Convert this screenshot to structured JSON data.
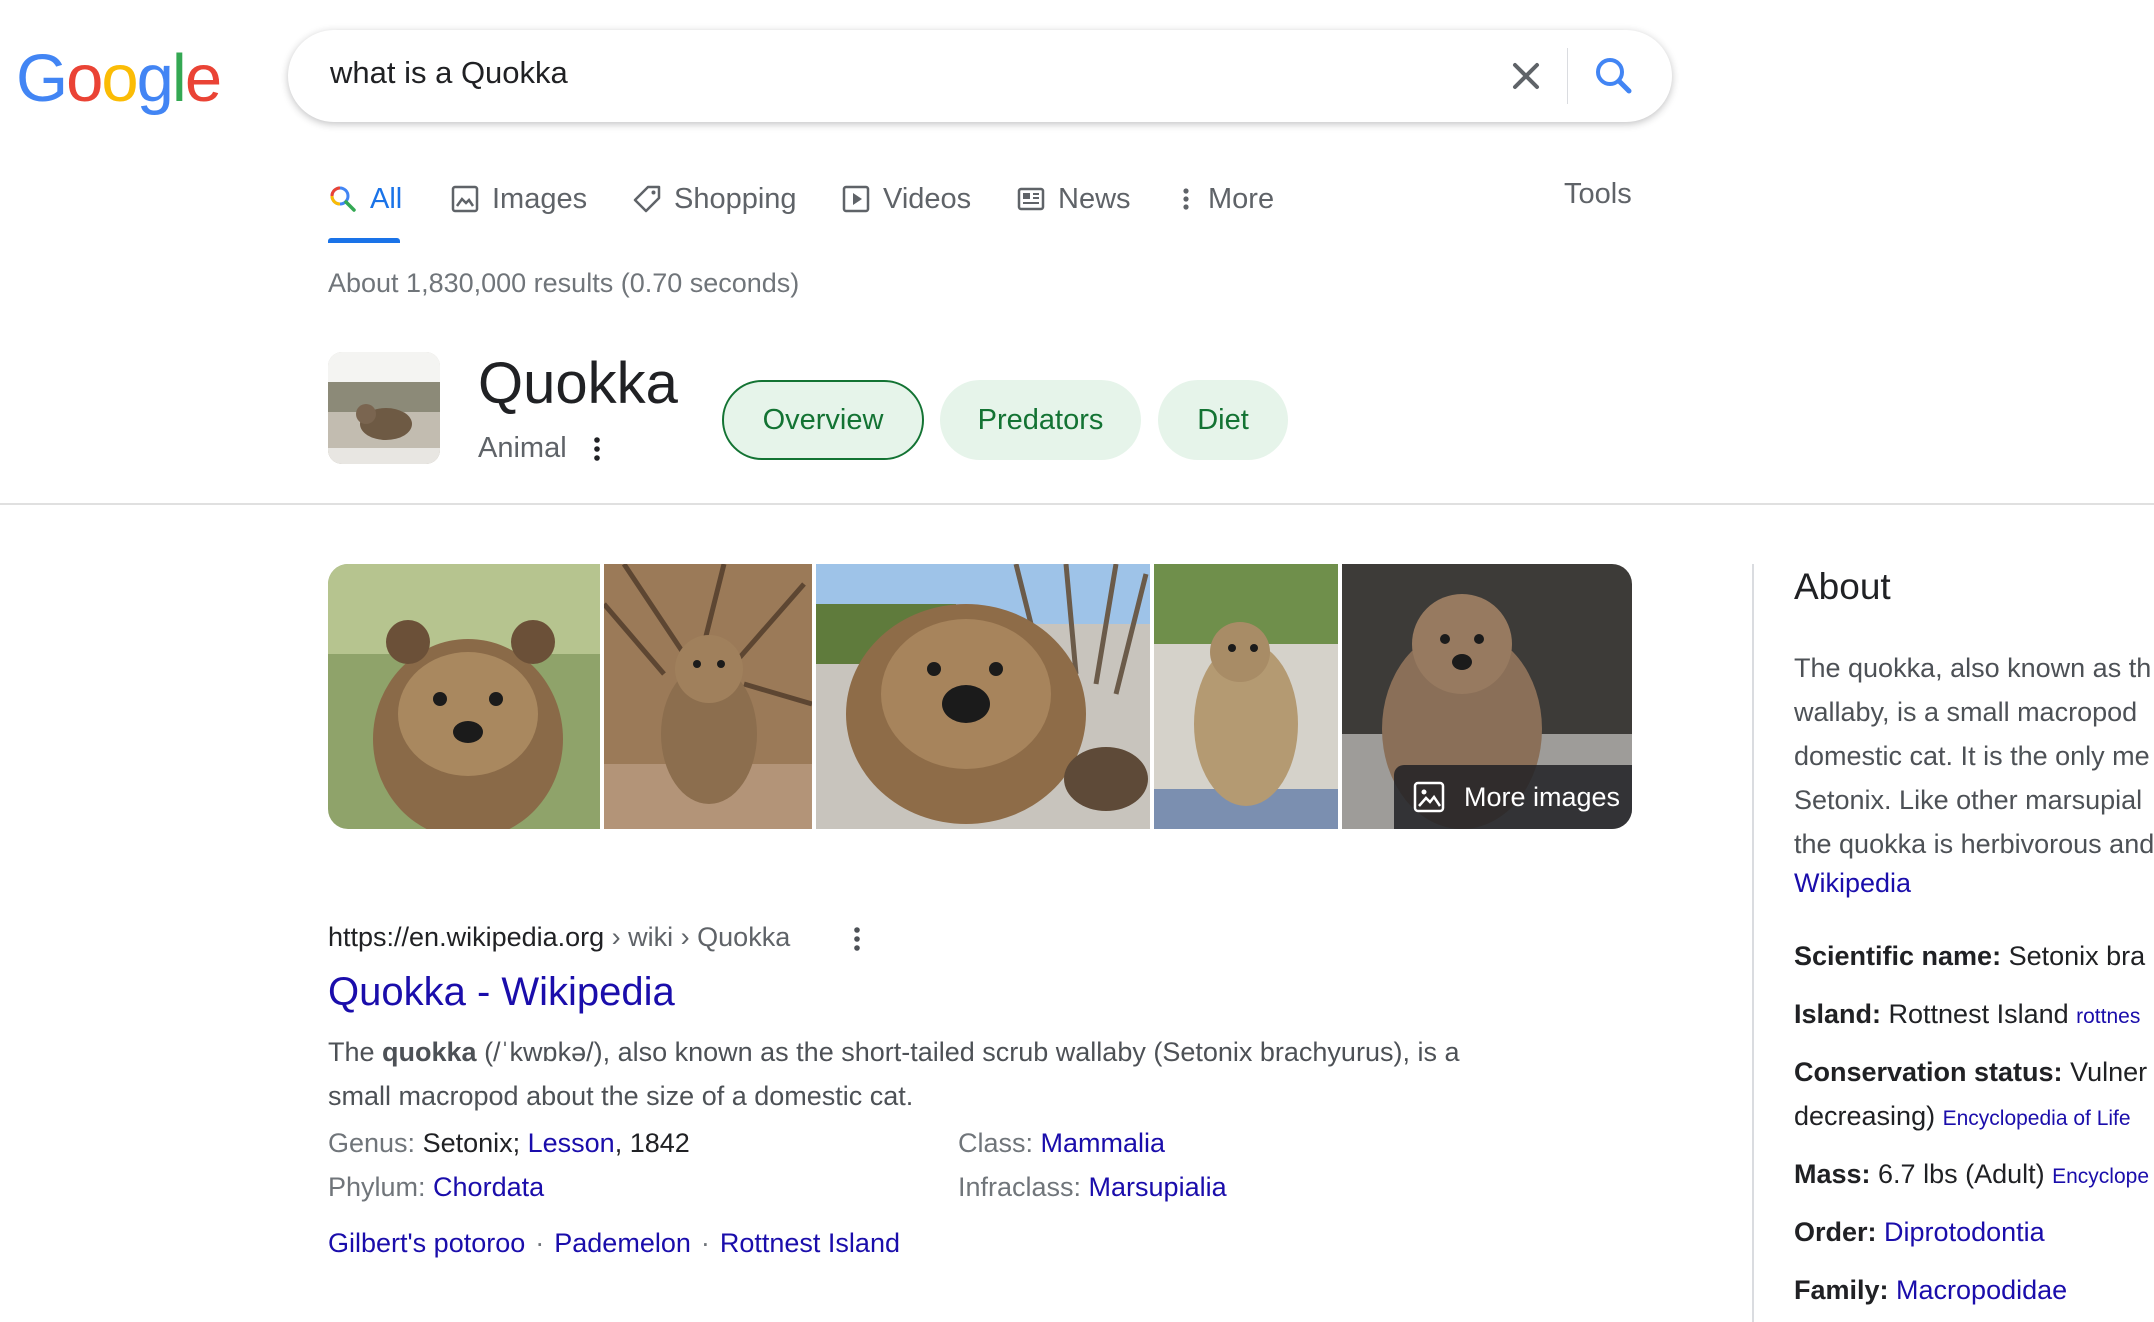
{
  "logo": {
    "letters": [
      "G",
      "o",
      "o",
      "g",
      "l",
      "e"
    ],
    "colors": [
      "#4285F4",
      "#EA4335",
      "#FBBC05",
      "#4285F4",
      "#34A853",
      "#EA4335"
    ]
  },
  "search": {
    "query": "what is a Quokka"
  },
  "tabs": [
    {
      "label": "All",
      "icon": "search-icon"
    },
    {
      "label": "Images",
      "icon": "image-icon"
    },
    {
      "label": "Shopping",
      "icon": "tag-icon"
    },
    {
      "label": "Videos",
      "icon": "play-icon"
    },
    {
      "label": "News",
      "icon": "newspaper-icon"
    },
    {
      "label": "More",
      "icon": "vertical-dots-icon"
    }
  ],
  "tools_label": "Tools",
  "stats": "About 1,830,000 results (0.70 seconds)",
  "entity": {
    "title": "Quokka",
    "subtitle": "Animal",
    "chips": [
      "Overview",
      "Predators",
      "Diet"
    ]
  },
  "images": {
    "more_label": "More images"
  },
  "result": {
    "url_domain": "https://en.wikipedia.org",
    "url_path": " › wiki › Quokka",
    "title": "Quokka - Wikipedia",
    "snippet_bold": "quokka",
    "snippet_pre": "The ",
    "snippet_post": " (/ˈkwɒkə/), also known as the short-tailed scrub wallaby (Setonix brachyurus), is a small macropod about the size of a domestic cat.",
    "facts": {
      "genus_label": "Genus: ",
      "genus_value": "Setonix; ",
      "genus_link": "Lesson",
      "genus_year": ", 1842",
      "class_label": "Class: ",
      "class_link": "Mammalia",
      "phylum_label": "Phylum: ",
      "phylum_link": "Chordata",
      "infraclass_label": "Infraclass: ",
      "infraclass_link": "Marsupialia"
    },
    "related": [
      "Gilbert's potoroo",
      "Pademelon",
      "Rottnest Island"
    ],
    "related_sep": "·"
  },
  "panel": {
    "heading": "About",
    "lines": [
      "The quokka, also known as th",
      "wallaby, is a small macropod",
      "domestic cat. It is the only me",
      "Setonix. Like other marsupial",
      "the quokka is herbivorous and"
    ],
    "source_link": "Wikipedia",
    "rows": [
      {
        "label": "Scientific name:",
        "value": " Setonix bra",
        "link": "",
        "src": ""
      },
      {
        "label": "Island:",
        "value": " Rottnest Island ",
        "link": "",
        "src": "rottnes"
      },
      {
        "label": "Conservation status:",
        "value": " Vulner",
        "link": "",
        "src": ""
      },
      {
        "label": "",
        "value": "decreasing) ",
        "link": "",
        "src": "Encyclopedia of Life"
      },
      {
        "label": "Mass:",
        "value": " 6.7 lbs (Adult) ",
        "link": "",
        "src": "Encyclope"
      },
      {
        "label": "Order:",
        "value": " ",
        "link": "Diprotodontia",
        "src": ""
      },
      {
        "label": "Family:",
        "value": " ",
        "link": "Macropodidae",
        "src": ""
      }
    ]
  }
}
